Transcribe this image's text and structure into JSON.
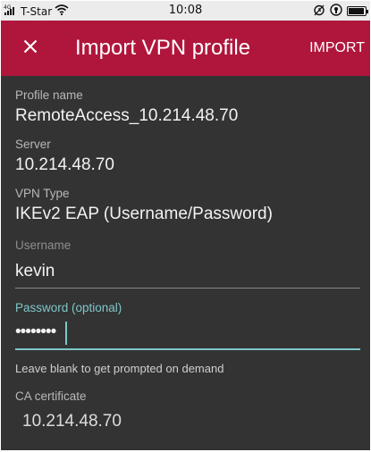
{
  "status_bar": {
    "signal_badge": "4G",
    "carrier": "T-Star",
    "time": "10:08",
    "icons": [
      "signal-icon",
      "wifi-icon",
      "alarm-icon",
      "vpn-key-icon",
      "battery-icon"
    ]
  },
  "app_bar": {
    "title": "Import VPN profile",
    "action_label": "IMPORT",
    "background_color": "#b0163c"
  },
  "form": {
    "profile_name": {
      "label": "Profile name",
      "value": "RemoteAccess_10.214.48.70"
    },
    "server": {
      "label": "Server",
      "value": "10.214.48.70"
    },
    "vpn_type": {
      "label": "VPN Type",
      "value": "IKEv2 EAP (Username/Password)"
    },
    "username": {
      "label": "Username",
      "value": "kevin"
    },
    "password": {
      "label": "Password (optional)",
      "value": "••••••••",
      "helper": "Leave blank to get prompted on demand"
    },
    "ca_certificate": {
      "label": "CA certificate",
      "value": "10.214.48.70"
    }
  },
  "colors": {
    "background": "#333333",
    "accent": "#7fc6c9",
    "brand": "#b0163c"
  }
}
